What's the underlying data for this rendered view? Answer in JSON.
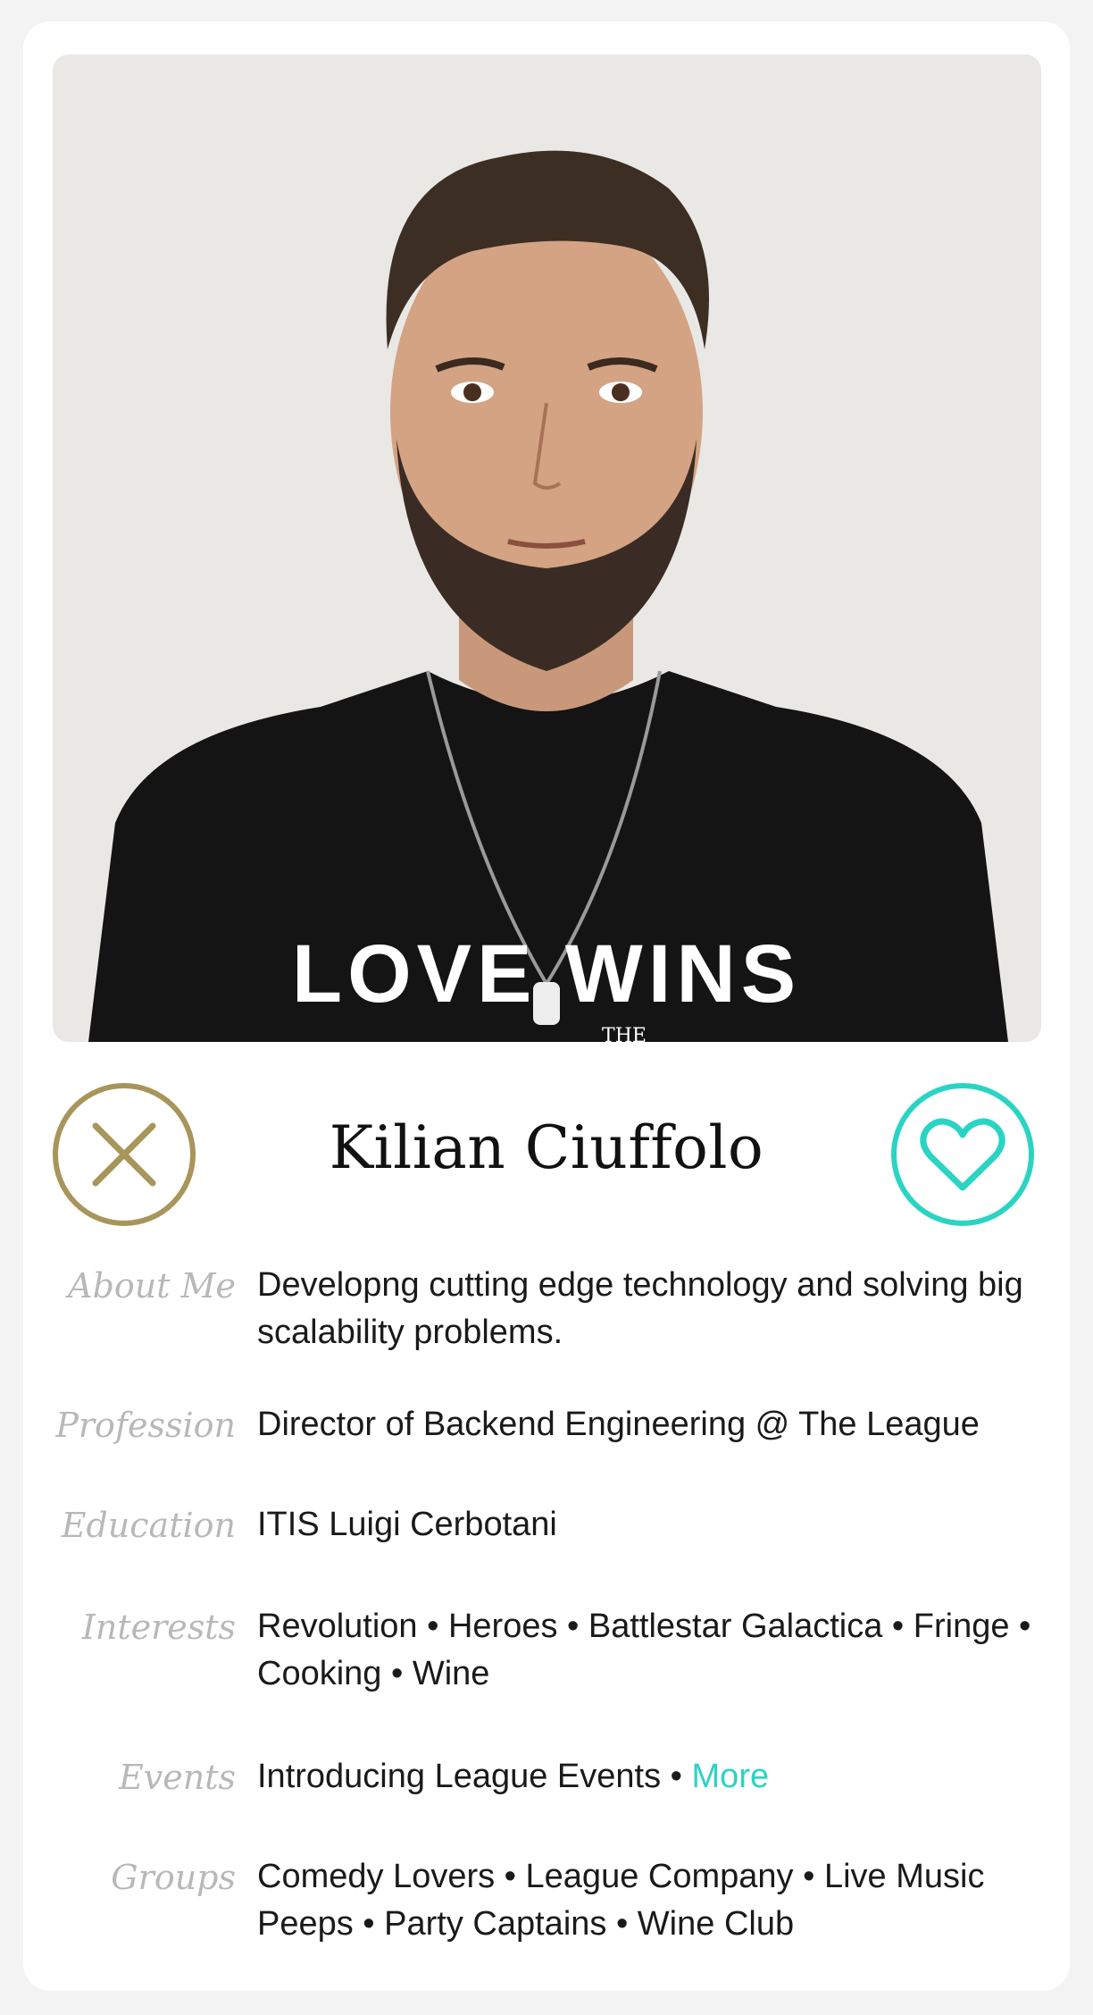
{
  "profile": {
    "name": "Kilian Ciuffolo",
    "photo": {
      "shirt_text": "LOVE WINS",
      "shirt_subtext": "THE"
    }
  },
  "actions": {
    "pass_icon": "x-icon",
    "like_icon": "heart-icon"
  },
  "details": {
    "about": {
      "label": "About Me",
      "value": "Developng cutting edge technology and solving big scalability problems."
    },
    "profession": {
      "label": "Profession",
      "value": "Director of Backend Engineering @ The League"
    },
    "education": {
      "label": "Education",
      "value": "ITIS Luigi Cerbotani"
    },
    "interests": {
      "label": "Interests",
      "value": "Revolution • Heroes • Battlestar Galactica • Fringe • Cooking • Wine"
    },
    "events": {
      "label": "Events",
      "value": "Introducing League Events • ",
      "more": "More"
    },
    "groups": {
      "label": "Groups",
      "value": "Comedy Lovers • League Company • Live Music Peeps • Party Captains • Wine Club"
    }
  },
  "colors": {
    "pass": "#a8955a",
    "like": "#2ad4c4",
    "label": "#b8b8b8"
  }
}
